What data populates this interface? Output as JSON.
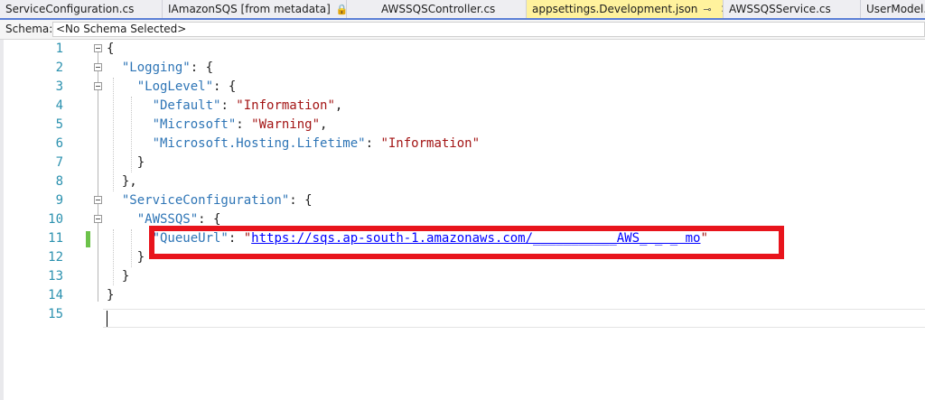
{
  "tabs": [
    {
      "label": "ServiceConfiguration.cs",
      "active": false
    },
    {
      "label": "IAmazonSQS [from metadata]",
      "active": false,
      "glyph": "lock-icon"
    },
    {
      "label": "AWSSQSController.cs",
      "active": false
    },
    {
      "label": "appsettings.Development.json",
      "active": true,
      "glyph": "pin-icon"
    },
    {
      "label": "AWSSQSService.cs",
      "active": false
    },
    {
      "label": "UserModel.cs",
      "active": false
    }
  ],
  "tab_glyphs": {
    "lock": "🔒",
    "pin": "⊸",
    "close": "✕"
  },
  "schema": {
    "label": "Schema:",
    "value": "<No Schema Selected>"
  },
  "editor": {
    "line_numbers": [
      "1",
      "2",
      "3",
      "4",
      "5",
      "6",
      "7",
      "8",
      "9",
      "10",
      "11",
      "12",
      "13",
      "14",
      "15"
    ],
    "lines": [
      [
        {
          "t": "{",
          "c": "p"
        }
      ],
      [
        {
          "t": "  ",
          "c": "p"
        },
        {
          "t": "\"Logging\"",
          "c": "k"
        },
        {
          "t": ": {",
          "c": "p"
        }
      ],
      [
        {
          "t": "    ",
          "c": "p"
        },
        {
          "t": "\"LogLevel\"",
          "c": "k"
        },
        {
          "t": ": {",
          "c": "p"
        }
      ],
      [
        {
          "t": "      ",
          "c": "p"
        },
        {
          "t": "\"Default\"",
          "c": "k"
        },
        {
          "t": ": ",
          "c": "p"
        },
        {
          "t": "\"Information\"",
          "c": "s"
        },
        {
          "t": ",",
          "c": "p"
        }
      ],
      [
        {
          "t": "      ",
          "c": "p"
        },
        {
          "t": "\"Microsoft\"",
          "c": "k"
        },
        {
          "t": ": ",
          "c": "p"
        },
        {
          "t": "\"Warning\"",
          "c": "s"
        },
        {
          "t": ",",
          "c": "p"
        }
      ],
      [
        {
          "t": "      ",
          "c": "p"
        },
        {
          "t": "\"Microsoft.Hosting.Lifetime\"",
          "c": "k"
        },
        {
          "t": ": ",
          "c": "p"
        },
        {
          "t": "\"Information\"",
          "c": "s"
        }
      ],
      [
        {
          "t": "    }",
          "c": "p"
        }
      ],
      [
        {
          "t": "  },",
          "c": "p"
        }
      ],
      [
        {
          "t": "  ",
          "c": "p"
        },
        {
          "t": "\"ServiceConfiguration\"",
          "c": "k"
        },
        {
          "t": ": {",
          "c": "p"
        }
      ],
      [
        {
          "t": "    ",
          "c": "p"
        },
        {
          "t": "\"AWSSQS\"",
          "c": "k"
        },
        {
          "t": ": {",
          "c": "p"
        }
      ],
      [
        {
          "t": "      ",
          "c": "p"
        },
        {
          "t": "\"QueueUrl\"",
          "c": "k"
        },
        {
          "t": ": ",
          "c": "p"
        },
        {
          "t": "\"",
          "c": "s"
        },
        {
          "t": "https://sqs.ap-south-1.amazonaws.com/___________AWS_ _ _ mo",
          "c": "u"
        },
        {
          "t": "\"",
          "c": "s"
        }
      ],
      [
        {
          "t": "    }",
          "c": "p"
        }
      ],
      [
        {
          "t": "  }",
          "c": "p"
        }
      ],
      [
        {
          "t": "}",
          "c": "p"
        }
      ],
      []
    ]
  },
  "colors": {
    "key": "#2e75b6",
    "string": "#a31515",
    "link": "#0000ff",
    "highlight_box": "#e8141c",
    "line_number": "#2b91af",
    "active_tab": "#fff29d"
  }
}
